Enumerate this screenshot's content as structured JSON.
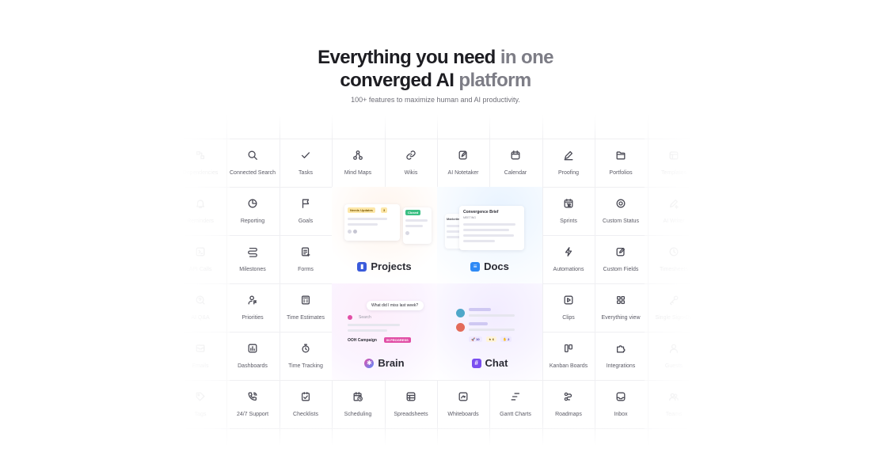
{
  "hero": {
    "line1_dark": "Everything you need",
    "line1_soft": "in one",
    "line2_dark": "converged AI",
    "line2_soft": "platform",
    "subtitle": "100+ features to maximize human and AI productivity."
  },
  "features": {
    "row1": [
      {
        "label": "Dependencies",
        "icon": "dependencies-icon"
      },
      {
        "label": "Connected Search",
        "icon": "search-icon"
      },
      {
        "label": "Tasks",
        "icon": "check-icon"
      },
      {
        "label": "Mind Maps",
        "icon": "mind-map-icon"
      },
      {
        "label": "Wikis",
        "icon": "link-icon"
      },
      {
        "label": "AI Notetaker",
        "icon": "notetaker-icon"
      },
      {
        "label": "Calendar",
        "icon": "calendar-icon"
      },
      {
        "label": "Proofing",
        "icon": "pen-icon"
      },
      {
        "label": "Portfolios",
        "icon": "folder-icon"
      },
      {
        "label": "Templates",
        "icon": "template-icon"
      }
    ],
    "row2_left": [
      {
        "label": "Reminders",
        "icon": "bell-icon"
      },
      {
        "label": "Reporting",
        "icon": "pie-chart-icon"
      },
      {
        "label": "Goals",
        "icon": "flag-icon"
      }
    ],
    "row2_right": [
      {
        "label": "Sprints",
        "icon": "sprint-calendar-icon"
      },
      {
        "label": "Custom Status",
        "icon": "target-icon"
      },
      {
        "label": "AI Writer",
        "icon": "ai-writer-icon"
      }
    ],
    "row3_left": [
      {
        "label": "API Calls",
        "icon": "api-icon"
      },
      {
        "label": "Milestones",
        "icon": "milestone-icon"
      },
      {
        "label": "Forms",
        "icon": "form-icon"
      }
    ],
    "row3_right": [
      {
        "label": "Automations",
        "icon": "bolt-icon"
      },
      {
        "label": "Custom Fields",
        "icon": "edit-field-icon"
      },
      {
        "label": "Timesheets",
        "icon": "clock-icon"
      }
    ],
    "row4_left": [
      {
        "label": "AI Q&A",
        "icon": "ai-qa-icon"
      },
      {
        "label": "Priorities",
        "icon": "priority-icon"
      },
      {
        "label": "Time Estimates",
        "icon": "calculator-icon"
      }
    ],
    "row4_right": [
      {
        "label": "Clips",
        "icon": "play-icon"
      },
      {
        "label": "Everything view",
        "icon": "grid-icon"
      },
      {
        "label": "Single Sign-On",
        "icon": "key-icon"
      }
    ],
    "row5_left": [
      {
        "label": "Emails",
        "icon": "mail-icon"
      },
      {
        "label": "Dashboards",
        "icon": "dashboard-icon"
      },
      {
        "label": "Time Tracking",
        "icon": "stopwatch-icon"
      }
    ],
    "row5_right": [
      {
        "label": "Kanban Boards",
        "icon": "kanban-icon"
      },
      {
        "label": "Integrations",
        "icon": "puzzle-icon"
      },
      {
        "label": "Guests",
        "icon": "user-icon"
      }
    ],
    "row6": [
      {
        "label": "Tags",
        "icon": "tag-icon"
      },
      {
        "label": "24/7 Support",
        "icon": "phone-icon"
      },
      {
        "label": "Checklists",
        "icon": "checklist-icon"
      },
      {
        "label": "Scheduling",
        "icon": "schedule-icon"
      },
      {
        "label": "Spreadsheets",
        "icon": "table-icon"
      },
      {
        "label": "Whiteboards",
        "icon": "whiteboard-icon"
      },
      {
        "label": "Gantt Charts",
        "icon": "gantt-icon"
      },
      {
        "label": "Roadmaps",
        "icon": "roadmap-icon"
      },
      {
        "label": "Inbox",
        "icon": "inbox-icon"
      },
      {
        "label": "Teams",
        "icon": "team-icon"
      }
    ]
  },
  "products": {
    "projects": {
      "label": "Projects",
      "accent": "#3b5bdb",
      "chip_needs_updates": "Needs Updates",
      "chip_count": "3",
      "chip_done": "Closed"
    },
    "docs": {
      "label": "Docs",
      "accent": "#2f8af5",
      "doc_title": "Convergence Brief",
      "side_word": "Marketing",
      "meta": "MEETING"
    },
    "brain": {
      "label": "Brain",
      "accent": "#e14fa6",
      "question": "What did I miss last week?",
      "search_placeholder": "Search",
      "campaign": "OOH Campaign",
      "status": "IN PROGRESS"
    },
    "chat": {
      "label": "Chat",
      "accent": "#7b4ff0",
      "reaction1": "10",
      "reaction2": "6",
      "reaction3": "2"
    }
  },
  "colors": {
    "icon_stroke": "#4a4a55",
    "grid_line": "#efeff2",
    "projects": "#3b5bdb",
    "docs": "#2f8af5",
    "brain": "#e14fa6",
    "chat": "#7b4ff0"
  }
}
